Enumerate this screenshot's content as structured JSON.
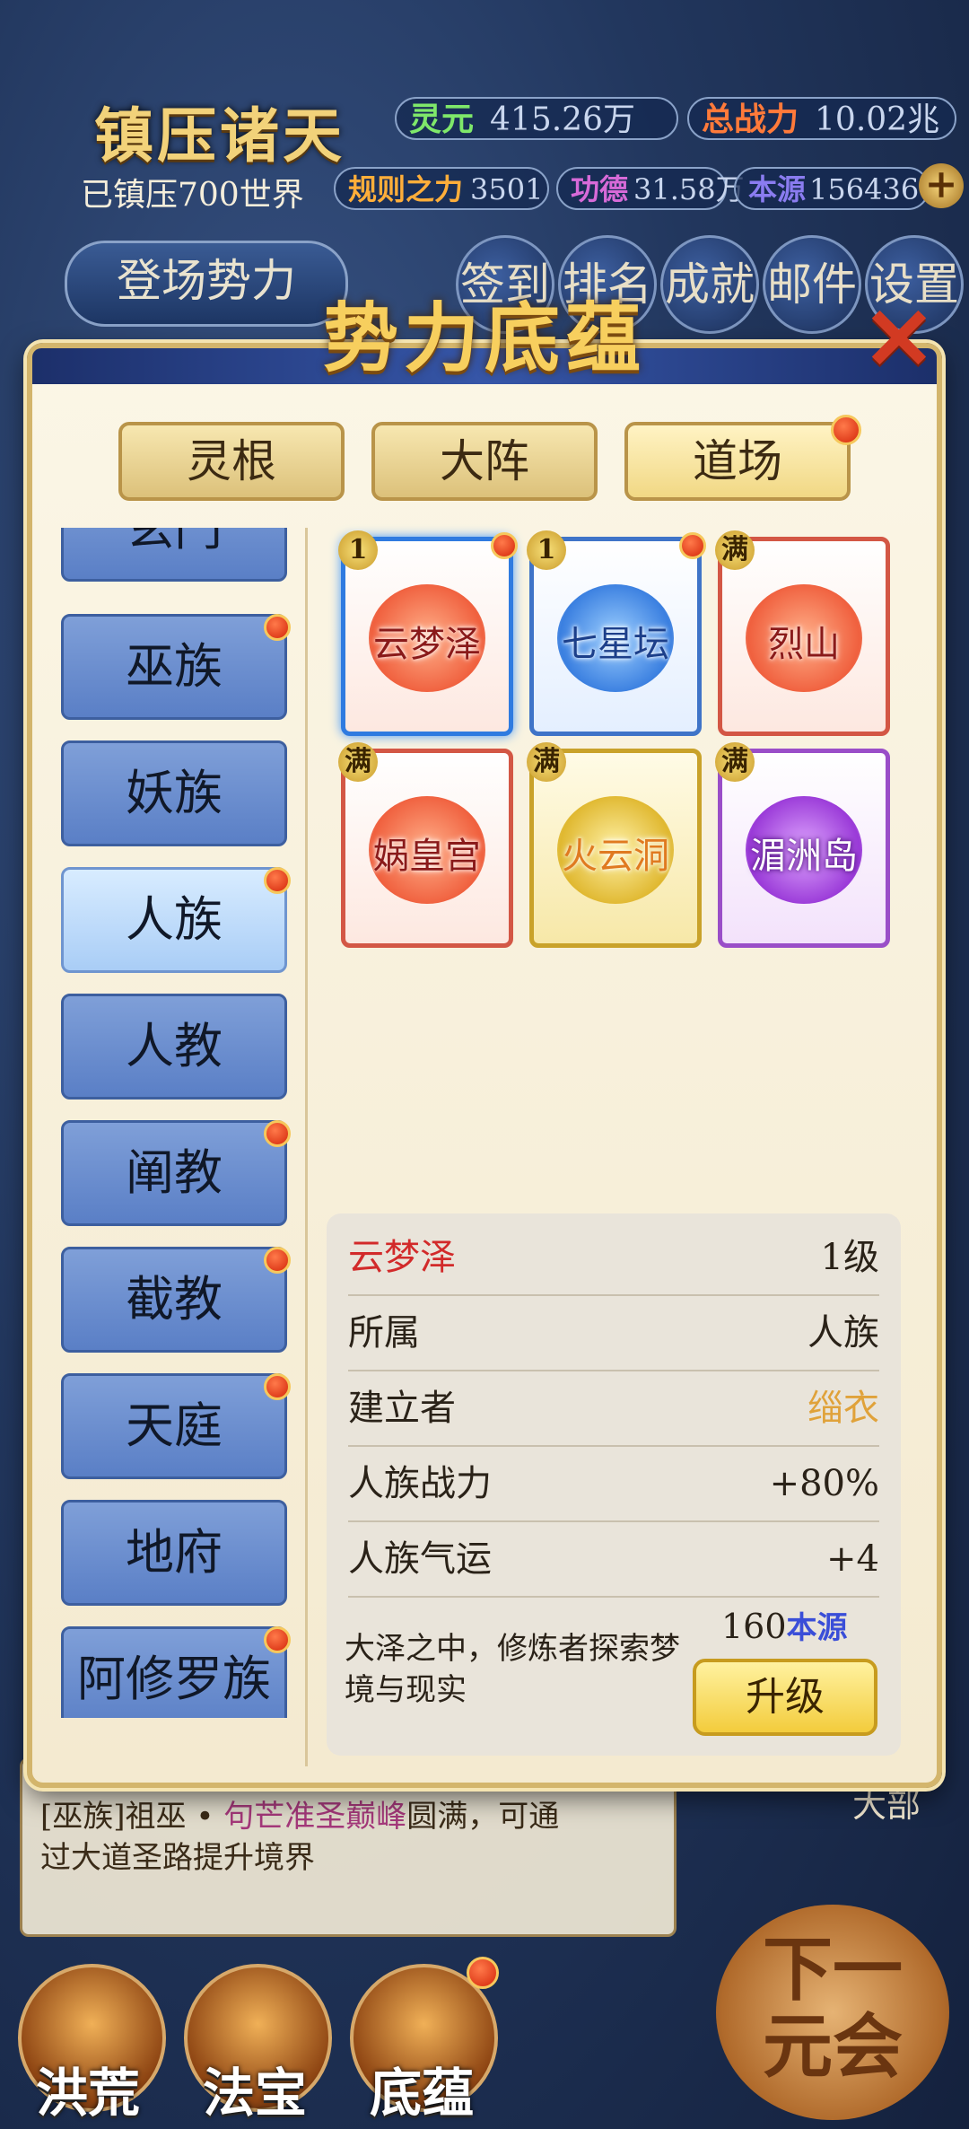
{
  "hud": {
    "title": "镇压诸天",
    "subtitle": "已镇压700世界",
    "stats": [
      {
        "label": "灵元",
        "value": "415.26万",
        "color": "#7fe86a"
      },
      {
        "label": "总战力",
        "value": "10.02兆",
        "color": "#ff7a3a"
      },
      {
        "label": "规则之力",
        "value": "3501",
        "color": "#ffae3a"
      },
      {
        "label": "功德",
        "value": "31.58万",
        "color": "#d76ad8"
      },
      {
        "label": "本源",
        "value": "156436",
        "color": "#8a7cf0"
      }
    ],
    "plus_label": "+",
    "force_button": "登场势力",
    "top_icons": [
      "签到",
      "排名",
      "成就",
      "邮件",
      "设置"
    ]
  },
  "dialog": {
    "title": "势力底蕴",
    "close_label": "✕",
    "tabs": [
      {
        "label": "灵根",
        "badge": false
      },
      {
        "label": "大阵",
        "badge": false
      },
      {
        "label": "道场",
        "badge": true
      }
    ],
    "sidebar": [
      {
        "label": "玄门",
        "badge": false
      },
      {
        "label": "巫族",
        "badge": true
      },
      {
        "label": "妖族",
        "badge": false
      },
      {
        "label": "人族",
        "badge": true
      },
      {
        "label": "人教",
        "badge": false
      },
      {
        "label": "阐教",
        "badge": true
      },
      {
        "label": "截教",
        "badge": true
      },
      {
        "label": "天庭",
        "badge": true
      },
      {
        "label": "地府",
        "badge": false
      },
      {
        "label": "阿修罗族",
        "badge": true
      }
    ],
    "cards": [
      {
        "name": "云梦泽",
        "level": "1",
        "badge": true,
        "theme": "red",
        "selected": true
      },
      {
        "name": "七星坛",
        "level": "1",
        "badge": true,
        "theme": "blue",
        "selected": false
      },
      {
        "name": "烈山",
        "level": "满",
        "badge": false,
        "theme": "red",
        "selected": false
      },
      {
        "name": "娲皇宫",
        "level": "满",
        "badge": false,
        "theme": "red",
        "selected": false
      },
      {
        "name": "火云洞",
        "level": "满",
        "badge": false,
        "theme": "gold",
        "selected": false
      },
      {
        "name": "湄洲岛",
        "level": "满",
        "badge": false,
        "theme": "purple",
        "selected": false
      }
    ],
    "info": {
      "name": "云梦泽",
      "level": "1级",
      "rows": [
        {
          "key": "所属",
          "value": "人族",
          "value_color": "#2a2218"
        },
        {
          "key": "建立者",
          "value": "缁衣",
          "value_color": "#e0a23a"
        },
        {
          "key": "人族战力",
          "value": "+80%",
          "value_color": "#2a2218"
        },
        {
          "key": "人族气运",
          "value": "+4",
          "value_color": "#2a2218"
        }
      ],
      "description": "大泽之中，修炼者探索梦境与现实",
      "cost_amount": "160",
      "cost_unit": "本源",
      "upgrade_label": "升级"
    }
  },
  "log": {
    "line1": "可通过大道圣路提升境界",
    "line2_prefix": "[巫族]祖巫 • ",
    "line2_highlight": "句芒准圣巅峰",
    "line2_suffix": "圆满，可通",
    "line3": "过大道圣路提升境界"
  },
  "bottom_nav": {
    "items": [
      {
        "label": "洪荒",
        "badge": false
      },
      {
        "label": "法宝",
        "badge": false
      },
      {
        "label": "底蕴",
        "badge": true
      }
    ],
    "next_line1": "下一",
    "next_line2": "元会",
    "side_text": "大部"
  }
}
